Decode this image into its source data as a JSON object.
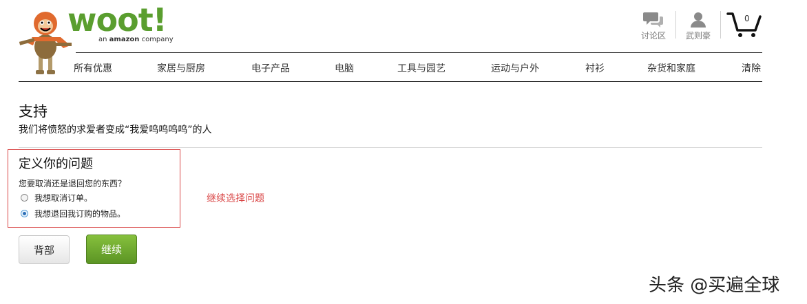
{
  "logo": {
    "word": "woot!",
    "tag_prefix": "an",
    "tag_brand": "amazon",
    "tag_suffix": "company"
  },
  "header": {
    "forums_label": "讨论区",
    "account_label": "武则豪",
    "cart_count": "0"
  },
  "nav": {
    "items": [
      "所有优惠",
      "家居与厨房",
      "电子产品",
      "电脑",
      "工具与园艺",
      "运动与户外",
      "衬衫",
      "杂货和家庭",
      "清除"
    ]
  },
  "page": {
    "title": "支持",
    "subtitle": "我们将愤怒的求爱者变成“我爱呜呜呜呜”的人"
  },
  "question": {
    "title": "定义你的问题",
    "prompt": "您要取消还是退回您的东西？",
    "options": [
      {
        "label": "我想取消订单。",
        "checked": false
      },
      {
        "label": "我想退回我订购的物品。",
        "checked": true
      }
    ]
  },
  "annotation": "继续选择问题",
  "buttons": {
    "back": "背部",
    "continue": "继续"
  },
  "watermark": "头条 @买遍全球",
  "colors": {
    "brand_green": "#5a9e2f",
    "highlight_red": "#d94545",
    "button_green": "#6ea62e"
  }
}
